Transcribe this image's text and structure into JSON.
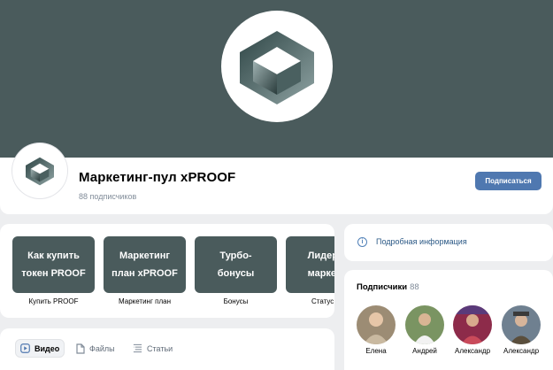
{
  "group": {
    "name": "Маркетинг-пул xPROOF",
    "subscribers_text": "88 подписчиков",
    "subscribe_label": "Подписаться"
  },
  "menu": [
    {
      "title": "Как купить\nтокен PROOF",
      "caption": "Купить PROOF"
    },
    {
      "title": "Маркетинг\nплан xPROOF",
      "caption": "Маркетинг план"
    },
    {
      "title": "Турбо-\nбонусы",
      "caption": "Бонусы"
    },
    {
      "title": "Лидеры\nмаркета",
      "caption": "Статус"
    }
  ],
  "info": {
    "label": "Подробная информация"
  },
  "subscribers": {
    "title": "Подписчики",
    "count": "88",
    "people": [
      {
        "name": "Елена",
        "color": "#b9a48a"
      },
      {
        "name": "Андрей",
        "color": "#6d8a5b"
      },
      {
        "name": "Александр",
        "color": "#a8324f"
      },
      {
        "name": "Александр",
        "color": "#8a7a5a"
      }
    ]
  },
  "tabs": [
    {
      "label": "Видео",
      "icon": "video-icon",
      "active": true
    },
    {
      "label": "Файлы",
      "icon": "file-icon",
      "active": false
    },
    {
      "label": "Статьи",
      "icon": "article-icon",
      "active": false
    }
  ],
  "colors": {
    "brand": "#4a5b5c",
    "accent": "#4f78b0",
    "link": "#2a5885"
  }
}
